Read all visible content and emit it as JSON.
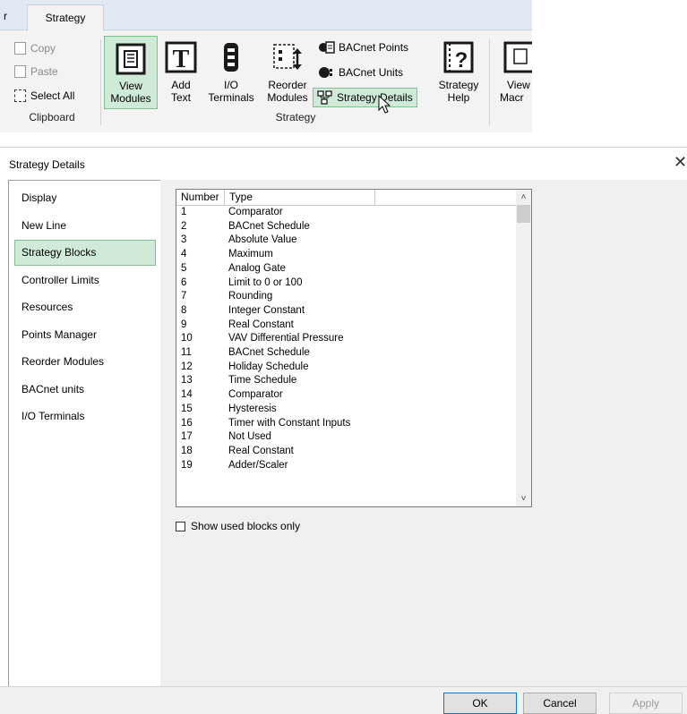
{
  "ribbon": {
    "prev_tab_fragment": "r",
    "active_tab": "Strategy",
    "clipboard": {
      "group_label": "Clipboard",
      "copy": "Copy",
      "paste": "Paste",
      "select_all": "Select All"
    },
    "strategy": {
      "group_label": "Strategy",
      "view_modules_line1": "View",
      "view_modules_line2": "Modules",
      "add_text_line1": "Add",
      "add_text_line2": "Text",
      "io_terminals_line1": "I/O",
      "io_terminals_line2": "Terminals",
      "reorder_line1": "Reorder",
      "reorder_line2": "Modules",
      "bacnet_points": "BACnet Points",
      "bacnet_units": "BACnet Units",
      "strategy_details": "Strategy Details",
      "help_line1": "Strategy",
      "help_line2": "Help",
      "view_macro_line1": "View",
      "view_macro_line2": "Macr"
    },
    "accent_color": "#cfead6"
  },
  "dialog": {
    "title": "Strategy Details",
    "close_glyph": "✕",
    "nav": [
      {
        "label": "Display"
      },
      {
        "label": "New Line"
      },
      {
        "label": "Strategy Blocks",
        "selected": true
      },
      {
        "label": "Controller Limits"
      },
      {
        "label": "Resources"
      },
      {
        "label": "Points Manager"
      },
      {
        "label": "Reorder Modules"
      },
      {
        "label": "BACnet units"
      },
      {
        "label": "I/O Terminals"
      }
    ],
    "list": {
      "headers": [
        "Number",
        "Type",
        ""
      ],
      "rows": [
        {
          "number": "1",
          "type": "Comparator"
        },
        {
          "number": "2",
          "type": "BACnet Schedule"
        },
        {
          "number": "3",
          "type": "Absolute Value"
        },
        {
          "number": "4",
          "type": "Maximum"
        },
        {
          "number": "5",
          "type": "Analog Gate"
        },
        {
          "number": "6",
          "type": "Limit to 0 or 100"
        },
        {
          "number": "7",
          "type": "Rounding"
        },
        {
          "number": "8",
          "type": "Integer Constant"
        },
        {
          "number": "9",
          "type": "Real Constant"
        },
        {
          "number": "10",
          "type": "VAV Differential Pressure"
        },
        {
          "number": "11",
          "type": "BACnet Schedule"
        },
        {
          "number": "12",
          "type": "Holiday Schedule"
        },
        {
          "number": "13",
          "type": "Time Schedule"
        },
        {
          "number": "14",
          "type": "Comparator"
        },
        {
          "number": "15",
          "type": "Hysteresis"
        },
        {
          "number": "16",
          "type": "Timer with Constant Inputs"
        },
        {
          "number": "17",
          "type": "Not Used"
        },
        {
          "number": "18",
          "type": "Real Constant"
        },
        {
          "number": "19",
          "type": "Adder/Scaler"
        }
      ]
    },
    "show_used_only": {
      "label": "Show used blocks only",
      "checked": false
    },
    "buttons": {
      "ok": "OK",
      "cancel": "Cancel",
      "apply": "Apply"
    }
  }
}
